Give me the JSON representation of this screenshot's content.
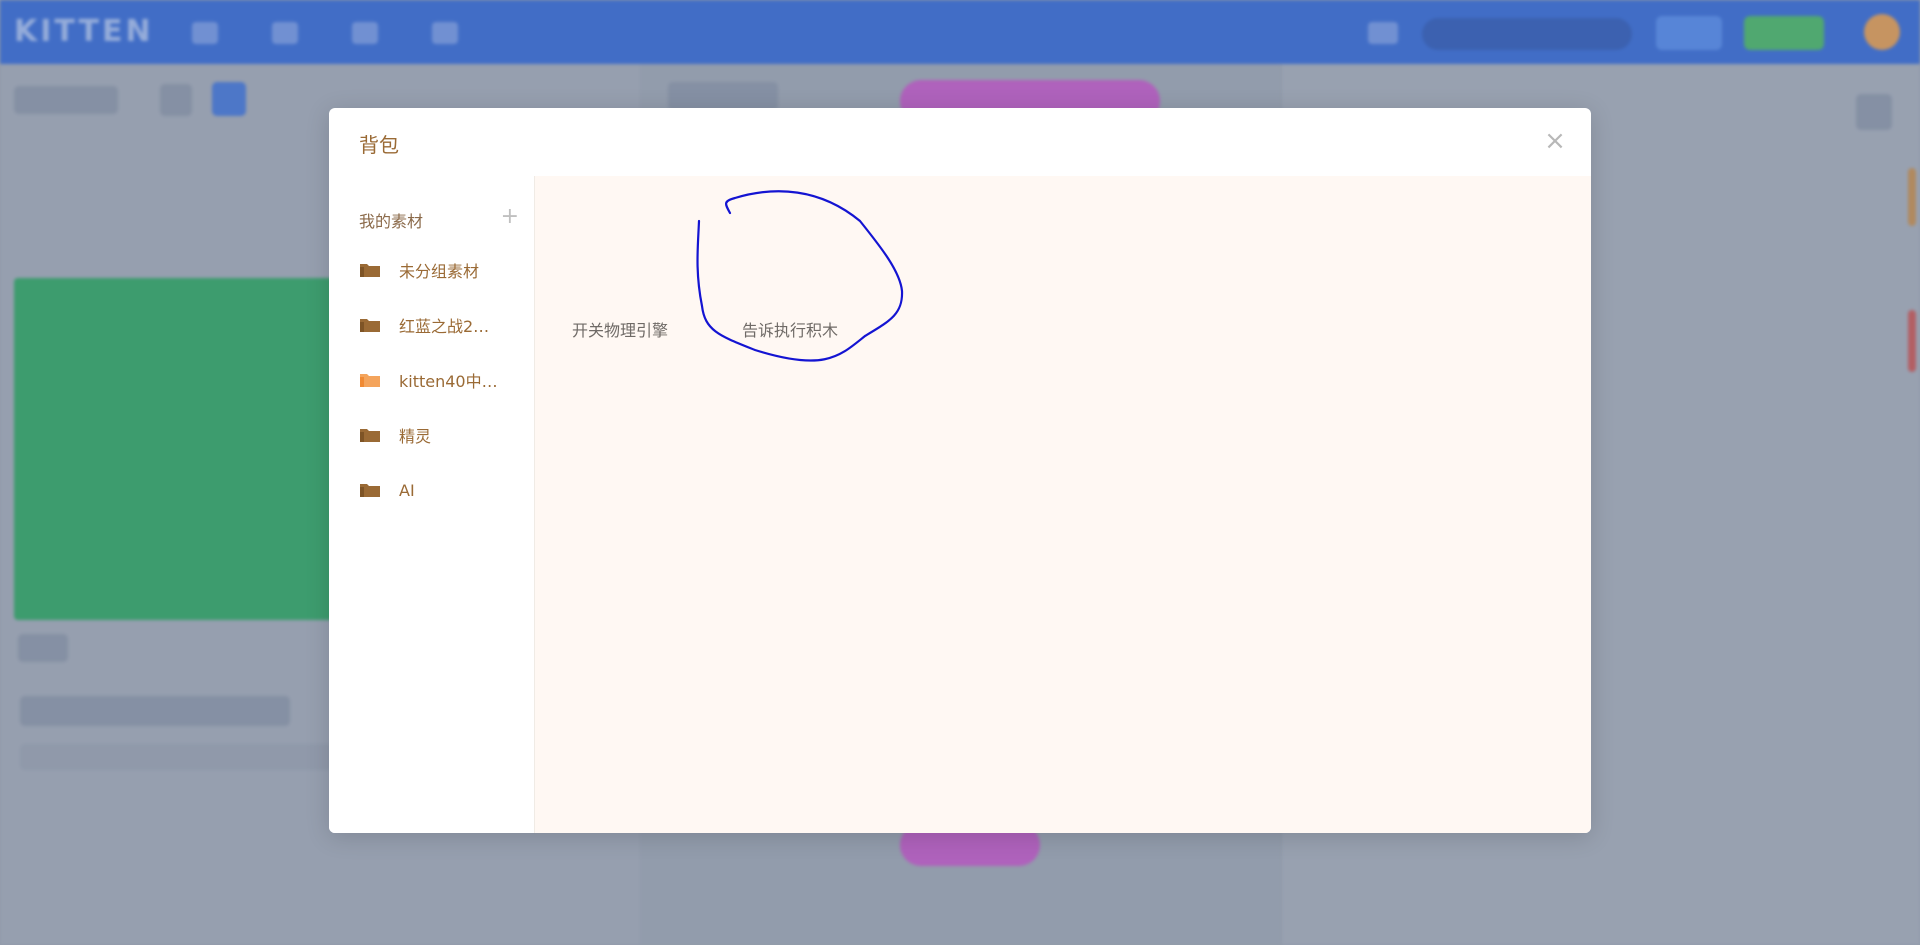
{
  "modal": {
    "title": "背包",
    "close_symbol": "×"
  },
  "sidebar": {
    "header_label": "我的素材",
    "add_symbol": "+",
    "folders": [
      {
        "label": "未分组素材",
        "icon": "folder-icon",
        "color": "#9a6a35"
      },
      {
        "label": "红蓝之战2…",
        "icon": "folder-icon",
        "color": "#9a6a35"
      },
      {
        "label": "kitten40中…",
        "icon": "folder-icon",
        "color": "#f08a33"
      },
      {
        "label": "精灵",
        "icon": "folder-icon",
        "color": "#9a6a35"
      },
      {
        "label": "AI",
        "icon": "folder-icon",
        "color": "#9a6a35"
      }
    ]
  },
  "content": {
    "assets": [
      {
        "label": "开关物理引擎"
      },
      {
        "label": "告诉执行积木"
      }
    ]
  },
  "background_app": {
    "logo": "KITTEN"
  },
  "colors": {
    "topbar": "#2f66d6",
    "accent_brown": "#9a6a35",
    "active_folder": "#f08a33",
    "annotation_stroke": "#1414d2"
  }
}
